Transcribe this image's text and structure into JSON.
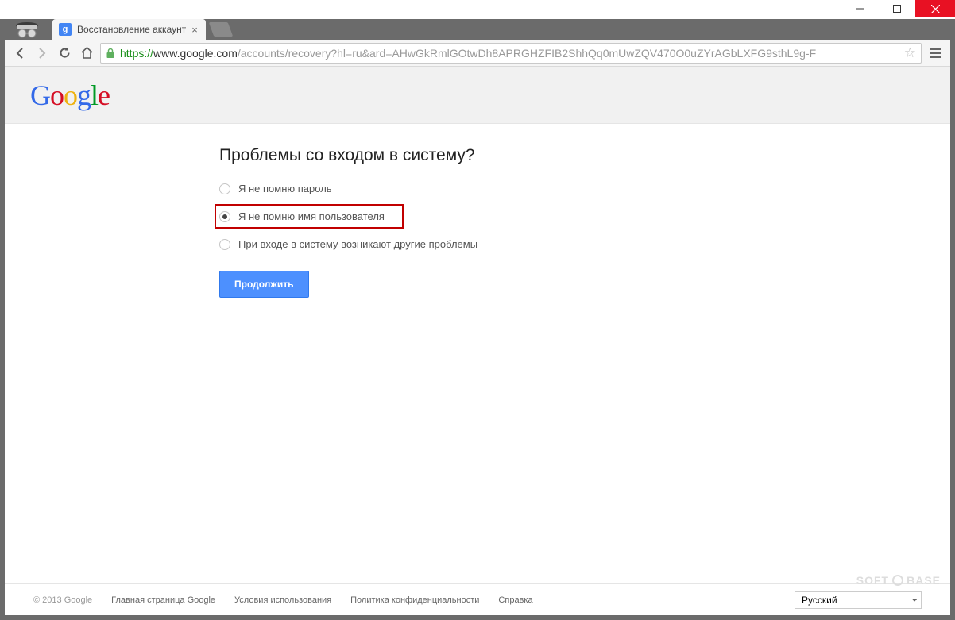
{
  "browser": {
    "tab": {
      "title": "Восстановление аккаунт",
      "favicon_letter": "g"
    },
    "url": {
      "scheme": "https://",
      "host": "www.google.com",
      "path": "/accounts/recovery?hl=ru&ard=AHwGkRmlGOtwDh8APRGHZFIB2ShhQq0mUwZQV470O0uZYrAGbLXFG9sthL9g-F"
    }
  },
  "header": {
    "logo_text": "Google"
  },
  "main": {
    "heading": "Проблемы со входом в систему?",
    "options": [
      {
        "label": "Я не помню пароль",
        "selected": false
      },
      {
        "label": "Я не помню имя пользователя",
        "selected": true
      },
      {
        "label": "При входе в систему возникают другие проблемы",
        "selected": false
      }
    ],
    "continue": "Продолжить"
  },
  "footer": {
    "copyright": "© 2013 Google",
    "links": [
      "Главная страница Google",
      "Условия использования",
      "Политика конфиденциальности",
      "Справка"
    ],
    "language_selected": "Русский"
  },
  "watermark": {
    "left": "SOFT",
    "right": "BASE"
  }
}
